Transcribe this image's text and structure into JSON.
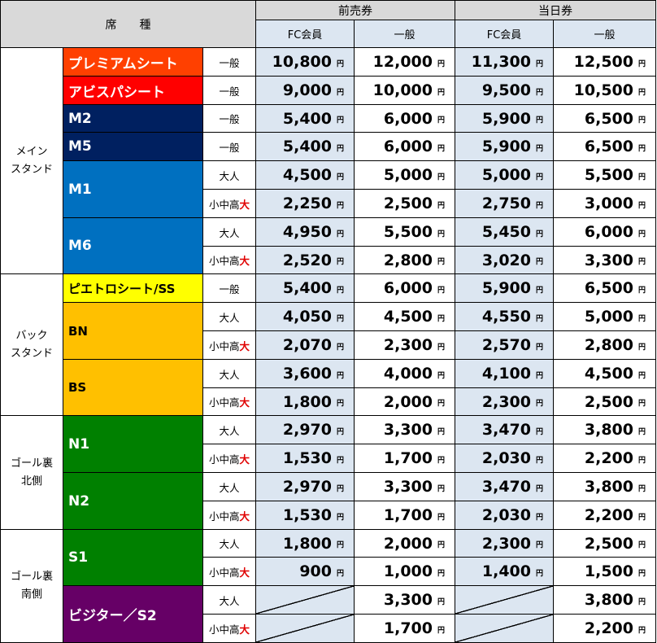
{
  "header": {
    "seat_type": "席　　種",
    "advance": "前売券",
    "same_day": "当日券",
    "fc_member": "FC会員",
    "general": "一般"
  },
  "yen_symbol": "円",
  "audience": {
    "general": "一般",
    "adult": "大人",
    "child_prefix": "小中高",
    "child_suffix": "大"
  },
  "groups": [
    {
      "area": "メイン\nスタンド",
      "seats": [
        {
          "name": "プレミアムシート",
          "color": "#ff4000",
          "text_color": "#ffffff",
          "rows": [
            {
              "audience": "general",
              "prices": [
                "10,800",
                "12,000",
                "11,300",
                "12,500"
              ]
            }
          ]
        },
        {
          "name": "アビスパシート",
          "color": "#ff0000",
          "text_color": "#ffffff",
          "rows": [
            {
              "audience": "general",
              "prices": [
                "9,000",
                "10,000",
                "9,500",
                "10,500"
              ]
            }
          ]
        },
        {
          "name": "M2",
          "color": "#002060",
          "text_color": "#ffffff",
          "rows": [
            {
              "audience": "general",
              "prices": [
                "5,400",
                "6,000",
                "5,900",
                "6,500"
              ]
            }
          ]
        },
        {
          "name": "M5",
          "color": "#002060",
          "text_color": "#ffffff",
          "rows": [
            {
              "audience": "general",
              "prices": [
                "5,400",
                "6,000",
                "5,900",
                "6,500"
              ]
            }
          ]
        },
        {
          "name": "M1",
          "color": "#0070c0",
          "text_color": "#ffffff",
          "rows": [
            {
              "audience": "adult",
              "prices": [
                "4,500",
                "5,000",
                "5,000",
                "5,500"
              ]
            },
            {
              "audience": "child",
              "prices": [
                "2,250",
                "2,500",
                "2,750",
                "3,000"
              ]
            }
          ]
        },
        {
          "name": "M6",
          "color": "#0070c0",
          "text_color": "#ffffff",
          "rows": [
            {
              "audience": "adult",
              "prices": [
                "4,950",
                "5,500",
                "5,450",
                "6,000"
              ]
            },
            {
              "audience": "child",
              "prices": [
                "2,520",
                "2,800",
                "3,020",
                "3,300"
              ]
            }
          ]
        }
      ]
    },
    {
      "area": "バック\nスタンド",
      "seats": [
        {
          "name": "ピエトロシート/SS",
          "color": "#ffff00",
          "text_color": "#000000",
          "rows": [
            {
              "audience": "general",
              "prices": [
                "5,400",
                "6,000",
                "5,900",
                "6,500"
              ]
            }
          ]
        },
        {
          "name": "BN",
          "color": "#ffc000",
          "text_color": "#000000",
          "rows": [
            {
              "audience": "adult",
              "prices": [
                "4,050",
                "4,500",
                "4,550",
                "5,000"
              ]
            },
            {
              "audience": "child",
              "prices": [
                "2,070",
                "2,300",
                "2,570",
                "2,800"
              ]
            }
          ]
        },
        {
          "name": "BS",
          "color": "#ffc000",
          "text_color": "#000000",
          "rows": [
            {
              "audience": "adult",
              "prices": [
                "3,600",
                "4,000",
                "4,100",
                "4,500"
              ]
            },
            {
              "audience": "child",
              "prices": [
                "1,800",
                "2,000",
                "2,300",
                "2,500"
              ]
            }
          ]
        }
      ]
    },
    {
      "area": "ゴール裏\n北側",
      "seats": [
        {
          "name": "N1",
          "color": "#008000",
          "text_color": "#ffffff",
          "rows": [
            {
              "audience": "adult",
              "prices": [
                "2,970",
                "3,300",
                "3,470",
                "3,800"
              ]
            },
            {
              "audience": "child",
              "prices": [
                "1,530",
                "1,700",
                "2,030",
                "2,200"
              ]
            }
          ]
        },
        {
          "name": "N2",
          "color": "#008000",
          "text_color": "#ffffff",
          "rows": [
            {
              "audience": "adult",
              "prices": [
                "2,970",
                "3,300",
                "3,470",
                "3,800"
              ]
            },
            {
              "audience": "child",
              "prices": [
                "1,530",
                "1,700",
                "2,030",
                "2,200"
              ]
            }
          ]
        }
      ]
    },
    {
      "area": "ゴール裏\n南側",
      "seats": [
        {
          "name": "S1",
          "color": "#008000",
          "text_color": "#ffffff",
          "rows": [
            {
              "audience": "adult",
              "prices": [
                "1,800",
                "2,000",
                "2,300",
                "2,500"
              ]
            },
            {
              "audience": "child",
              "prices": [
                "900",
                "1,000",
                "1,400",
                "1,500"
              ]
            }
          ]
        },
        {
          "name": "ビジター／S2",
          "color": "#660066",
          "text_color": "#ffffff",
          "rows": [
            {
              "audience": "adult",
              "prices": [
                null,
                "3,300",
                null,
                "3,800"
              ]
            },
            {
              "audience": "child",
              "prices": [
                null,
                "1,700",
                null,
                "2,200"
              ]
            }
          ]
        }
      ]
    }
  ]
}
